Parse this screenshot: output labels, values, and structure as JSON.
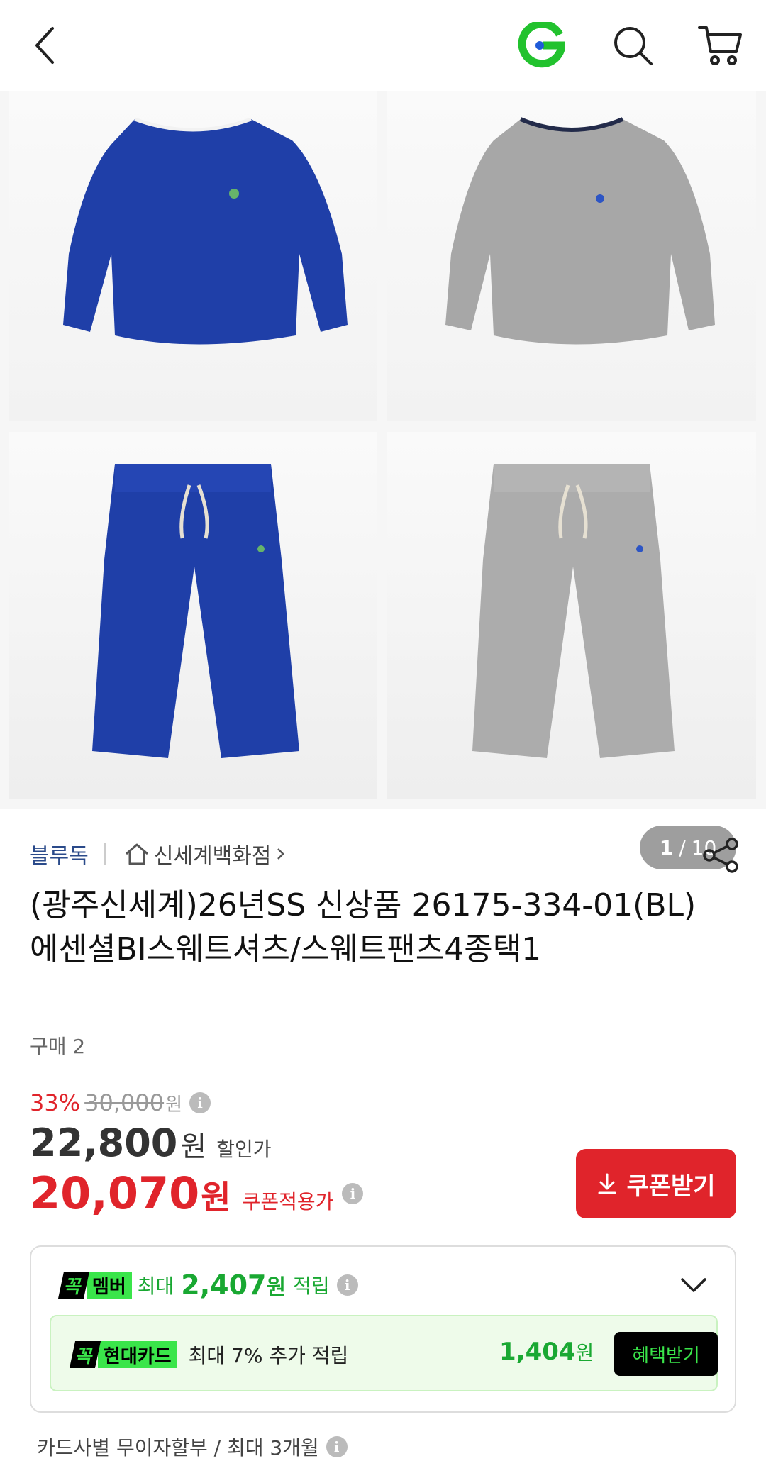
{
  "header": {
    "icons": [
      "back-icon",
      "g-logo-icon",
      "search-icon",
      "cart-icon"
    ]
  },
  "gallery": {
    "counter_current": "1",
    "counter_sep": "/",
    "counter_total": "10"
  },
  "product": {
    "brand": "블루독",
    "store": "신세계백화점",
    "title": "(광주신세계)26년SS 신상품 26175-334-01(BL) 에센셜BI스웨트셔츠/스웨트팬츠4종택1",
    "purchase_count": "구매 2"
  },
  "price": {
    "discount_rate": "33%",
    "original": "30,000",
    "original_unit": "원",
    "sale": "22,800",
    "sale_unit": "원",
    "sale_label": "할인가",
    "coupon_price": "20,070",
    "coupon_unit": "원",
    "coupon_label": "쿠폰적용가",
    "coupon_button": "쿠폰받기"
  },
  "member": {
    "badge_k": "꼭",
    "badge_label": "멤버",
    "max_label": "최대",
    "amount": "2,407",
    "unit": "원",
    "earn": "적립"
  },
  "card": {
    "badge_k": "꼭",
    "badge_label": "현대카드",
    "desc": "최대 7% 추가 적립",
    "amount": "1,404",
    "unit": "원",
    "button": "혜택받기"
  },
  "installment": "카드사별 무이자할부 / 최대 3개월",
  "colors": {
    "accent_red": "#e0242b",
    "green": "#19a832",
    "brand_blue": "#2a4a8a"
  }
}
